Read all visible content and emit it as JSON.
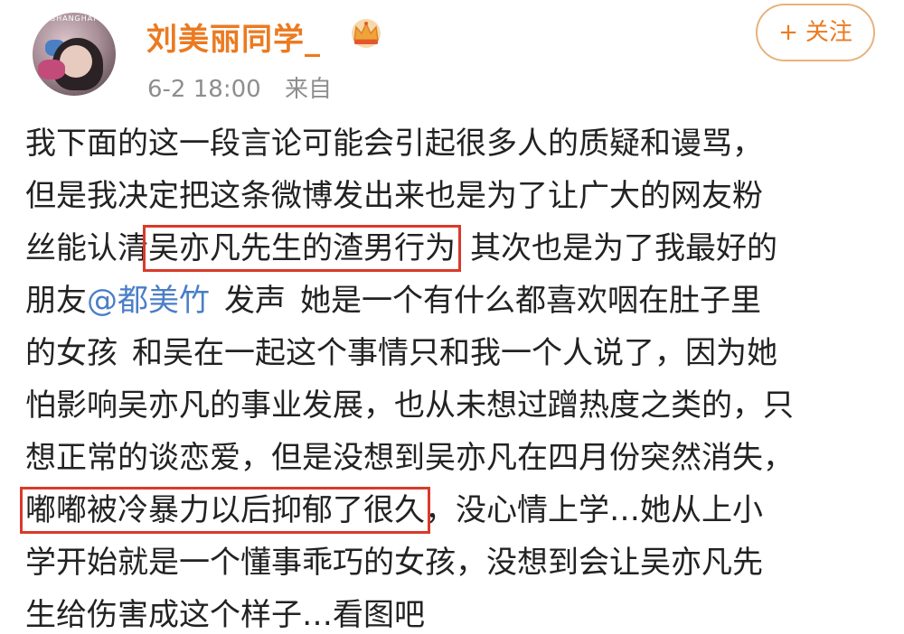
{
  "author": {
    "name": "刘美丽同学_",
    "avatar_text": "SHANGHAI",
    "badge_icon": "crown-icon"
  },
  "meta": {
    "timestamp": "6-2 18:00",
    "source": "来自"
  },
  "follow": {
    "plus": "+",
    "label": "关注"
  },
  "colors": {
    "username": "#eb7a20",
    "meta": "#8e8e8e",
    "mention": "#4a7ec7",
    "highlight_box": "#d93a2b",
    "body_text": "#222222"
  },
  "body": {
    "l1": "我下面的这一段言论可能会引起很多人的质疑和谩骂，",
    "l2": "但是我决定把这条微博发出来也是为了让广大的网友粉",
    "l3a": "丝能认清",
    "l3_highlight": "吴亦凡先生的渣男行为",
    "l3b": "其次也是为了我最好的",
    "l4a": "朋友",
    "l4_mention": "@都美竹",
    "l4b": "发声",
    "l4c": "她是一个有什么都喜欢咽在肚子里",
    "l5a": "的女孩",
    "l5b": "和吴在一起这个事情只和我一个人说了，因为她",
    "l6": "怕影响吴亦凡的事业发展，也从未想过蹭热度之类的，只",
    "l7": "想正常的谈恋爱，但是没想到吴亦凡在四月份突然消失，",
    "l8_highlight": "嘟嘟被冷暴力以后抑郁了很久",
    "l8b": "，没心情上学…她从上小",
    "l9": "学开始就是一个懂事乖巧的女孩，没想到会让吴亦凡先",
    "l10": "生给伤害成这个样子…看图吧"
  }
}
